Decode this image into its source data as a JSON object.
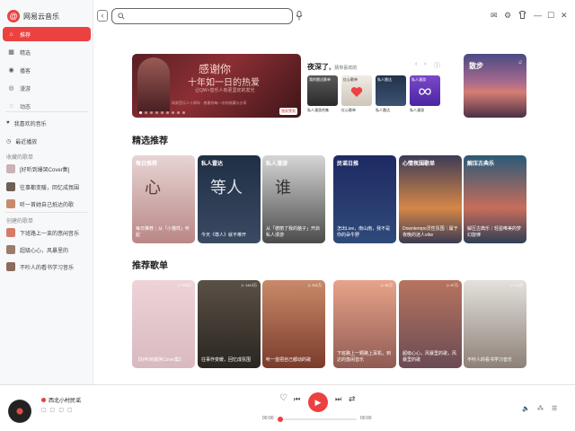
{
  "app": {
    "name": "网易云音乐",
    "logo_glyph": "@"
  },
  "nav": [
    {
      "label": "推荐",
      "icon": "home-icon",
      "glyph": "⌂",
      "active": true
    },
    {
      "label": "精选",
      "icon": "grid-icon",
      "glyph": "▦"
    },
    {
      "label": "播客",
      "icon": "podcast-icon",
      "glyph": "◉"
    },
    {
      "label": "漫游",
      "icon": "roam-icon",
      "glyph": "◎"
    },
    {
      "label": "动态",
      "icon": "feed-icon",
      "glyph": "◌"
    }
  ],
  "library": [
    {
      "label": "我喜欢的音乐",
      "icon": "heart-icon",
      "glyph": "♥"
    },
    {
      "label": "最近播放",
      "icon": "clock-icon",
      "glyph": "◷"
    }
  ],
  "collected": {
    "title": "收藏的歌单",
    "items": [
      {
        "label": "[好听到爆哭Cover集]",
        "color": "#c9b3b7"
      },
      {
        "label": "往事都变暖，回忆成氛围",
        "color": "#6d5f55"
      },
      {
        "label": "听一首她自己抵达的歌",
        "color": "#c98a6a"
      }
    ]
  },
  "created": {
    "title": "创建的歌单",
    "items": [
      {
        "label": "下班路上一束的悠闲音乐",
        "color": "#d47b68"
      },
      {
        "label": "超级心心，风暴里的",
        "color": "#9b7b6e"
      },
      {
        "label": "不吵人的看书学习音乐",
        "color": "#8b6b5c"
      }
    ]
  },
  "search": {
    "placeholder": ""
  },
  "window": {
    "mail": "✉",
    "settings": "⚙",
    "minimize": "—",
    "maximize": "☐",
    "close": "✕"
  },
  "banner": {
    "line1": "感谢你",
    "line2": "十年如一日的热爱",
    "line3": "让QW+音乐人有更坚定的发光",
    "line4": "网易音乐人十周年 · 感谢你每一次的收藏与分享",
    "tag": "独家策划",
    "dots": 9
  },
  "daily": {
    "title": "夜深了,",
    "subtitle": "猜你喜欢的",
    "prev": "‹",
    "next": "›",
    "info": "ⓘ",
    "cards": [
      {
        "label": "我的雷达歌单",
        "caption": "私人漫游合集",
        "color": "#3d3d3d"
      },
      {
        "label": "红心歌单",
        "caption": "红心歌单",
        "color": "#e9e3dc"
      },
      {
        "label": "私人雷达",
        "caption": "私人雷达",
        "color": "#2b3a52"
      },
      {
        "label": "私人漫游",
        "caption": "私人漫游",
        "color": "#6a3ab3"
      }
    ]
  },
  "side_banner": {
    "title": "散步",
    "icon": "♫"
  },
  "featured": {
    "title": "精选推荐",
    "cards": [
      {
        "head": "每日推荐",
        "title": "每日推荐｜从「小猫样」听起",
        "deco": "心",
        "c1": "#e7d4d4",
        "c2": "#b98786"
      },
      {
        "head": "私人雷达",
        "title": "今天《尊人》就不难开",
        "deco": "等人",
        "c1": "#1f2f44",
        "c2": "#3b4a63"
      },
      {
        "head": "私人漫游",
        "title": "从「德丽了我的脑子」开启私人漫游",
        "deco": "谁",
        "c1": "#c8c8c8",
        "c2": "#4b4b4b"
      },
      {
        "head": "民谣日推",
        "title": "怎出Live，南山南，我不是你的朵牛野",
        "deco": "",
        "c1": "#1e2a63",
        "c2": "#2f4a7a"
      },
      {
        "head": "心情氛围歌单",
        "title": "Downtempo灵性氛围｜属于夜晚的迷人vibe",
        "deco": "",
        "c1": "#d58747",
        "c2": "#3d3b58"
      },
      {
        "head": "解压古典乐",
        "title": "解压古典乐｜轻盈唯美的梦幻旋律",
        "deco": "",
        "c1": "#2a5a78",
        "c2": "#c86d5b"
      }
    ]
  },
  "playlists": {
    "title": "推荐歌单",
    "cards": [
      {
        "count": "▷ 538万",
        "title": "【好听到爆哭Cover集】",
        "c1": "#e8c9cf",
        "c2": "#d8b9c0"
      },
      {
        "count": "▷ 1413万",
        "title": "往事作变暖，回忆成氛围",
        "c1": "#4a4238",
        "c2": "#2b2620"
      },
      {
        "count": "▷ 201万",
        "title": "听一首把自己都动的歌",
        "c1": "#7a3b2b",
        "c2": "#c98a6a"
      },
      {
        "count": "▷ 81万",
        "title": "下班路上一颗路上耳机，到达的悠闲音乐",
        "c1": "#e8a48a",
        "c2": "#8f5b53"
      },
      {
        "count": "▷ 67万",
        "title": "超级心心，风暴里的歌，风暴里的歌",
        "c1": "#b7745e",
        "c2": "#6a4b55"
      },
      {
        "count": "▷ 2.4万",
        "title": "不吵人的看书学习音乐",
        "c1": "#e4e1dc",
        "c2": "#8d8178"
      }
    ]
  },
  "player": {
    "song": "西北小村民谣",
    "current": "00:00",
    "total": "00:00",
    "progress": 0.0,
    "icons": {
      "like": "♡",
      "prev": "⏮",
      "play": "▶",
      "next": "⏭",
      "shuffle": "⇄",
      "volume": "🔈",
      "list": "☰",
      "lyrics": "⁂"
    }
  }
}
